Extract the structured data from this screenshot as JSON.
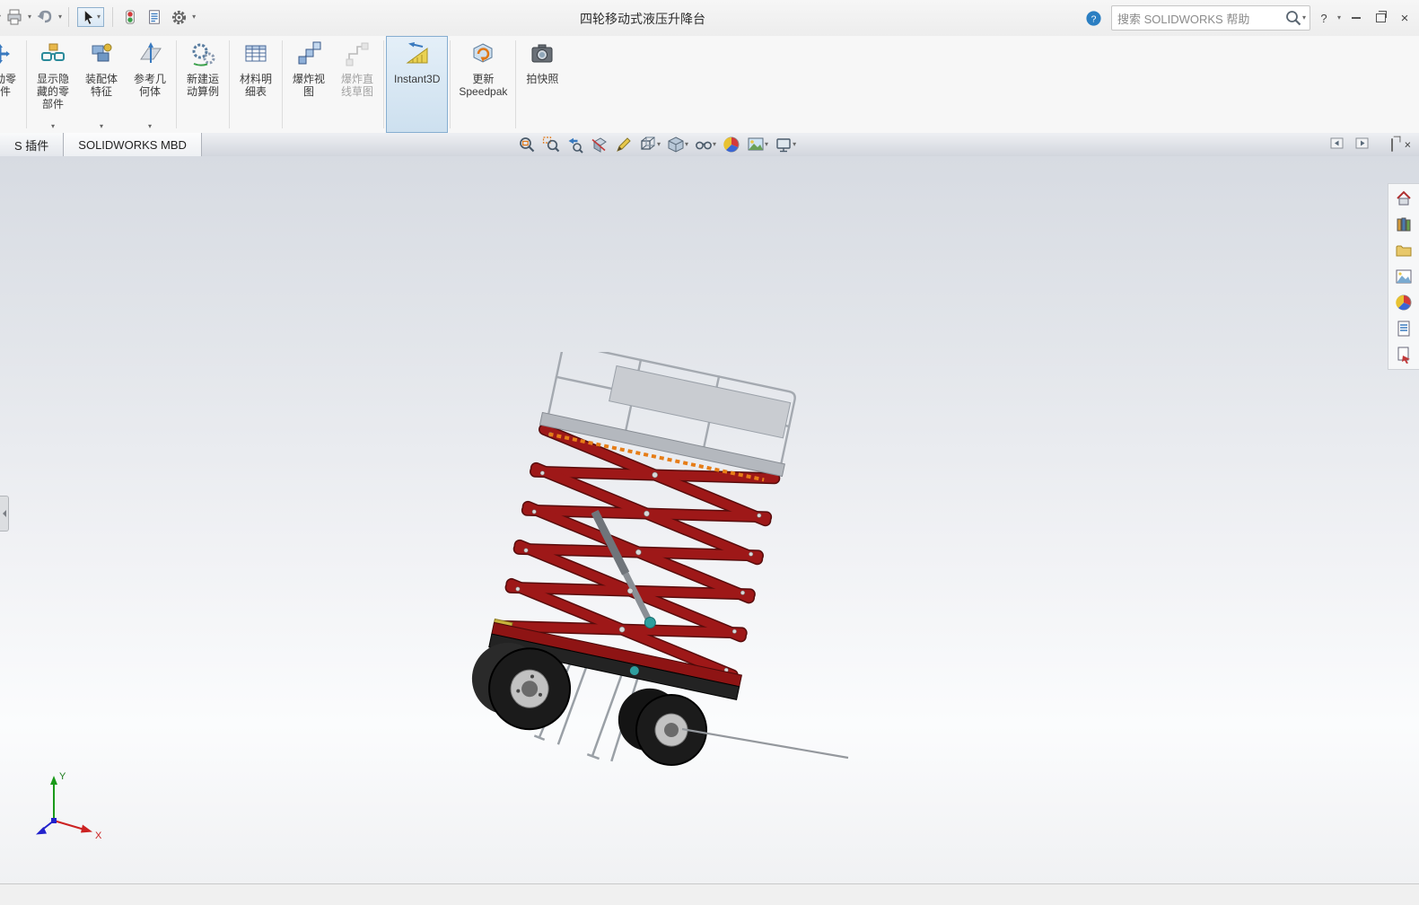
{
  "icons": {
    "chevron": "▾",
    "close": "×",
    "help": "?"
  },
  "window": {
    "title": "四轮移动式液压升降台",
    "search_text": "搜索 SOLIDWORKS 帮助"
  },
  "ribbon": {
    "buttons": [
      {
        "label": "移动零部件"
      },
      {
        "label": "显示隐藏的零部件"
      },
      {
        "label": "装配体特征"
      },
      {
        "label": "参考几何体"
      },
      {
        "label": "新建运动算例"
      },
      {
        "label": "材料明细表"
      },
      {
        "label": "爆炸视图"
      },
      {
        "label": "爆炸直线草图"
      },
      {
        "label": "Instant3D"
      },
      {
        "label": "更新 Speedpak"
      },
      {
        "label": "拍快照"
      }
    ]
  },
  "tabs": [
    {
      "label": "S 插件"
    },
    {
      "label": "SOLIDWORKS MBD"
    }
  ],
  "triad": {
    "x": "X",
    "y": "Y"
  },
  "status": {
    "text": ""
  },
  "colors": {
    "model_red": "#9e1818",
    "selection_highlight": "#cde0ef",
    "viewport_top": "#d7dbe2"
  }
}
